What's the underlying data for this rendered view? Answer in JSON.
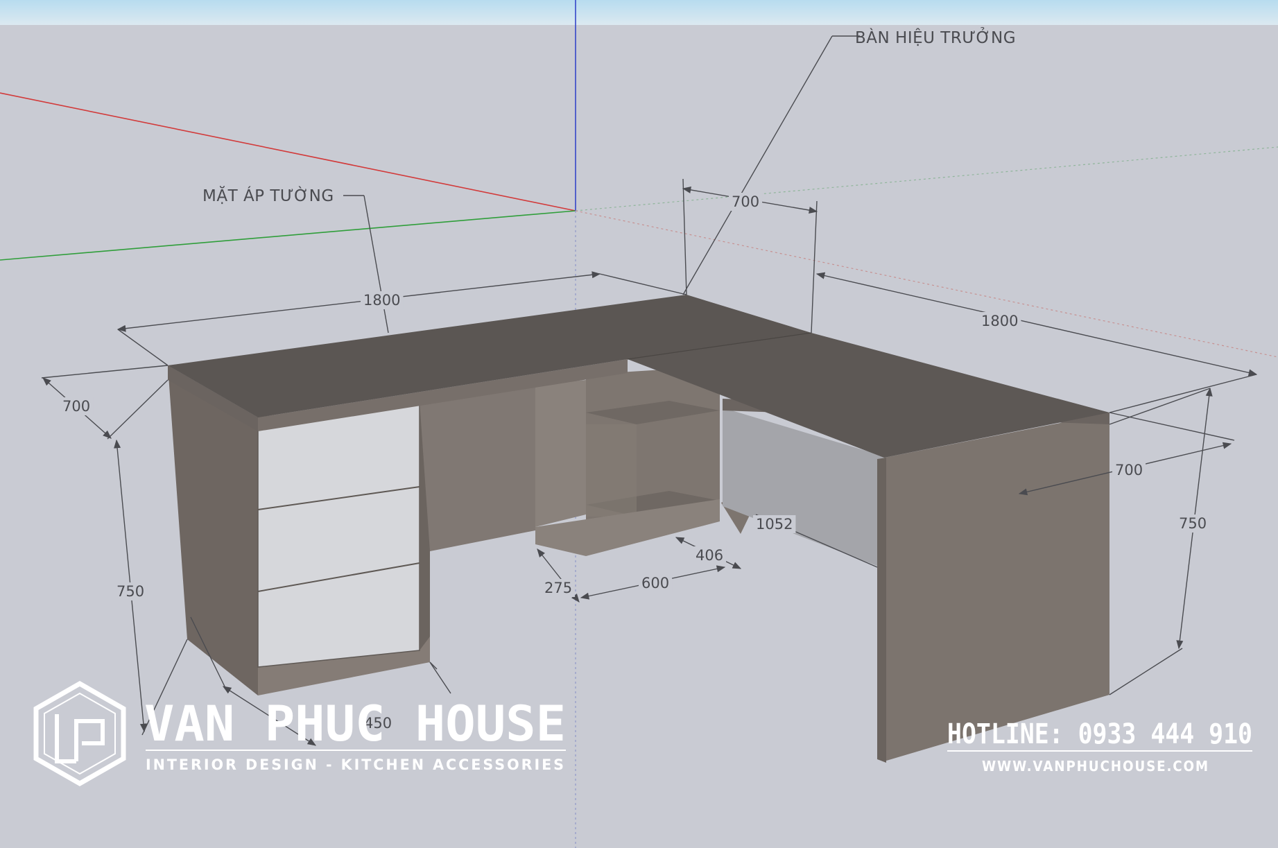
{
  "callouts": {
    "wall_side": "MẶT ÁP TƯỜNG",
    "principal_desk": "BÀN HIỆU TRƯỞNG"
  },
  "dimensions": {
    "top_length_left": "1800",
    "top_length_right": "1800",
    "depth_left": "700",
    "depth_return_top": "700",
    "depth_return_end": "700",
    "height_left": "750",
    "height_right": "750",
    "drawer_width": "450",
    "gap_275": "275",
    "cabinet_600": "600",
    "leg_406": "406",
    "panel_1052": "1052"
  },
  "branding": {
    "company": "VAN PHUC HOUSE",
    "tagline": "INTERIOR DESIGN - KITCHEN ACCESSORIES",
    "hotline": "HOTLINE: 0933 444 910",
    "website": "WWW.VANPHUCHOUSE.COM"
  },
  "colors": {
    "background": "#c9cbd3",
    "desk_top": "#5a5552",
    "desk_side": "#7b736e",
    "drawer_front": "#d7d8dc",
    "axis_red": "#d23a3a",
    "axis_green": "#2f9e3a",
    "axis_blue": "#3546c9"
  }
}
